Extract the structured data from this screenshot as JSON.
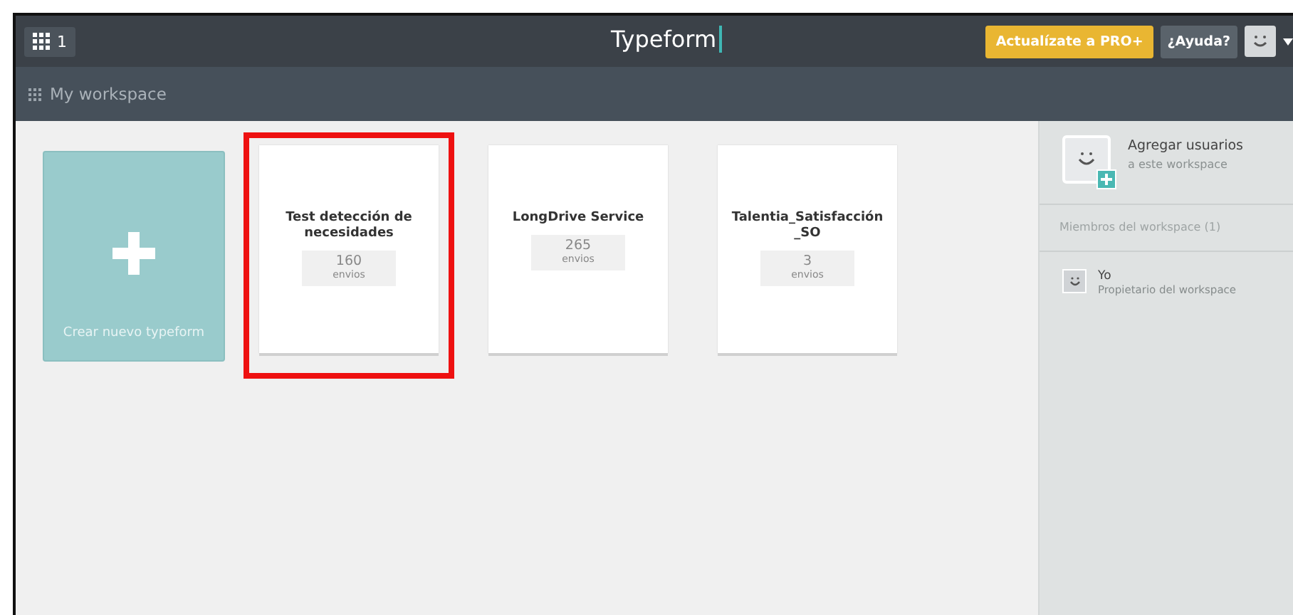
{
  "topbar": {
    "workspaces_count": "1",
    "logo": "Typeform",
    "upgrade_button": "Actualízate a PRO+",
    "help_button": "¿Ayuda?"
  },
  "subbar": {
    "title": "My workspace"
  },
  "create_card": {
    "label": "Crear nuevo typeform"
  },
  "forms": [
    {
      "title": "Test detección de necesidades",
      "count": "160",
      "count_label": "envios",
      "highlighted": true
    },
    {
      "title": "LongDrive Service",
      "count": "265",
      "count_label": "envios",
      "highlighted": false
    },
    {
      "title": "Talentia_Satisfacción _SO",
      "count": "3",
      "count_label": "envios",
      "highlighted": false
    }
  ],
  "sidebar": {
    "add_users_title": "Agregar usuarios",
    "add_users_subtitle": "a este workspace",
    "members_heading": "Miembros del workspace (1)",
    "members": [
      {
        "name": "Yo",
        "role": "Propietario del workspace"
      }
    ]
  }
}
